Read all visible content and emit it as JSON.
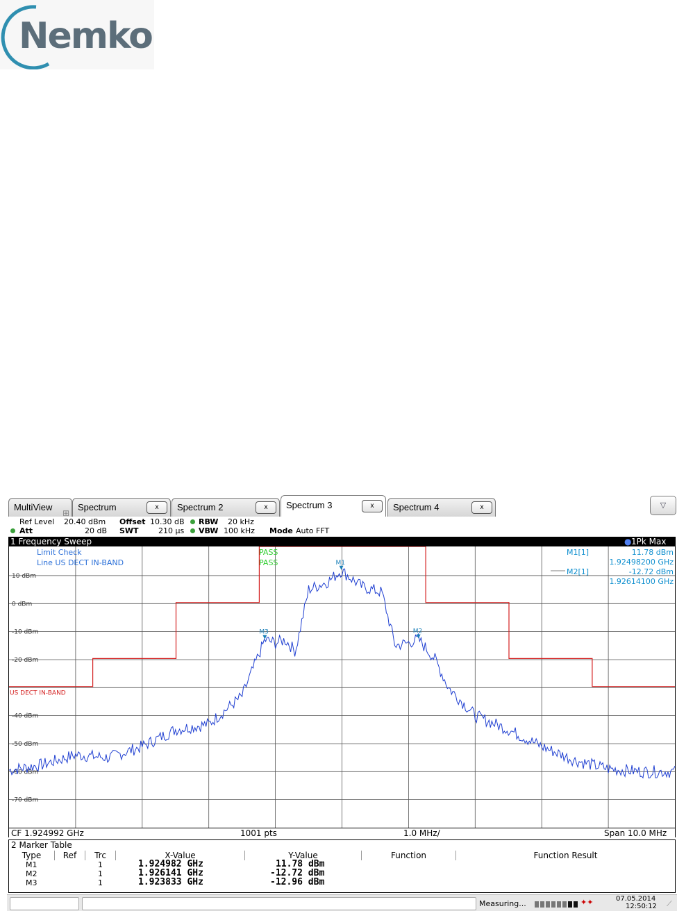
{
  "logo": {
    "text": "Nemko"
  },
  "tabs": [
    {
      "label": "MultiView"
    },
    {
      "label": "Spectrum",
      "close": "x"
    },
    {
      "label": "Spectrum 2",
      "close": "x"
    },
    {
      "label": "Spectrum 3",
      "close": "x",
      "active": true
    },
    {
      "label": "Spectrum 4",
      "close": "x"
    }
  ],
  "tab_dropdown": "▽",
  "settings": {
    "ref_level_label": "Ref Level",
    "ref_level_value": "20.40 dBm",
    "offset_label": "Offset",
    "offset_value": "10.30 dB",
    "rbw_label": "RBW",
    "rbw_value": "20 kHz",
    "att_label": "Att",
    "att_value": "20 dB",
    "swt_label": "SWT",
    "swt_value": "210 µs",
    "vbw_label": "VBW",
    "vbw_value": "100 kHz",
    "mode_label": "Mode",
    "mode_value": "Auto FFT"
  },
  "sweep_window": {
    "title": "1 Frequency Sweep",
    "trace_label": "1Pk Max",
    "limit_check_label": "Limit Check",
    "limit_check_result": "PASS",
    "line_label": "Line US DECT IN-BAND",
    "line_result": "PASS",
    "limit_line_name": "US DECT IN-BAND",
    "m1_label": "M1[1]",
    "m1_level": "11.78 dBm",
    "m1_freq": "1.92498200 GHz",
    "m2_label": "M2[1]",
    "m2_level": "-12.72 dBm",
    "m2_freq": "1.92614100 GHz"
  },
  "chart_data": {
    "type": "line",
    "y_tick_labels": [
      "10 dBm",
      "0 dBm",
      "-10 dBm",
      "-20 dBm",
      "-40 dBm",
      "-50 dBm",
      "-60 dBm",
      "-70 dBm"
    ],
    "ylim": [
      -80,
      20.4
    ],
    "xlim": [
      1.919992,
      1.929992
    ],
    "x_unit": "GHz",
    "grid": true,
    "trace_color": "#1f3fd1",
    "limit_color": "#d42020",
    "series": [
      {
        "name": "1Pk Max",
        "x": [
          1.919992,
          1.920492,
          1.920992,
          1.921492,
          1.921992,
          1.922492,
          1.922992,
          1.923492,
          1.923833,
          1.923992,
          1.924142,
          1.924292,
          1.924492,
          1.924792,
          1.924982,
          1.925292,
          1.925592,
          1.925792,
          1.925992,
          1.926141,
          1.926392,
          1.926592,
          1.926992,
          1.927492,
          1.927992,
          1.928492,
          1.928992,
          1.929492,
          1.929992
        ],
        "values": [
          -59.5,
          -57.5,
          -54,
          -55,
          -51,
          -45,
          -43,
          -33,
          -12.96,
          -14,
          -13,
          -17,
          5,
          8,
          11.78,
          6,
          4,
          -15,
          -14,
          -12.72,
          -20,
          -30,
          -40,
          -45,
          -51,
          -56,
          -59,
          -60,
          -60
        ]
      }
    ],
    "limit_line": {
      "name": "US DECT IN-BAND",
      "x": [
        1.919992,
        1.92125,
        1.92125,
        1.9225,
        1.9225,
        1.92375,
        1.92375,
        1.92625,
        1.92625,
        1.9275,
        1.9275,
        1.92875,
        1.92875,
        1.929992
      ],
      "values": [
        -29.6,
        -29.6,
        -19.6,
        -19.6,
        0.4,
        0.4,
        20.4,
        20.4,
        0.4,
        0.4,
        -19.6,
        -19.6,
        -29.6,
        -29.6
      ]
    },
    "markers": [
      {
        "name": "M1",
        "x": 1.924982,
        "y": 11.78
      },
      {
        "name": "M2",
        "x": 1.926141,
        "y": -12.72
      },
      {
        "name": "M3",
        "x": 1.923833,
        "y": -12.96
      }
    ]
  },
  "sweep_footer": {
    "cf": "CF 1.924992 GHz",
    "pts": "1001 pts",
    "div": "1.0 MHz/",
    "span": "Span 10.0 MHz"
  },
  "marker_table": {
    "title": "2 Marker Table",
    "headers": [
      "Type",
      "Ref",
      "Trc",
      "X-Value",
      "Y-Value",
      "Function",
      "Function Result"
    ],
    "rows": [
      {
        "type": "M1",
        "ref": "",
        "trc": "1",
        "x": "1.924982 GHz",
        "y": "11.78 dBm"
      },
      {
        "type": "M2",
        "ref": "",
        "trc": "1",
        "x": "1.926141 GHz",
        "y": "-12.72 dBm"
      },
      {
        "type": "M3",
        "ref": "",
        "trc": "1",
        "x": "1.923833 GHz",
        "y": "-12.96 dBm"
      }
    ]
  },
  "status": {
    "measuring": "Measuring...",
    "date": "07.05.2014",
    "time": "12:50:12"
  }
}
